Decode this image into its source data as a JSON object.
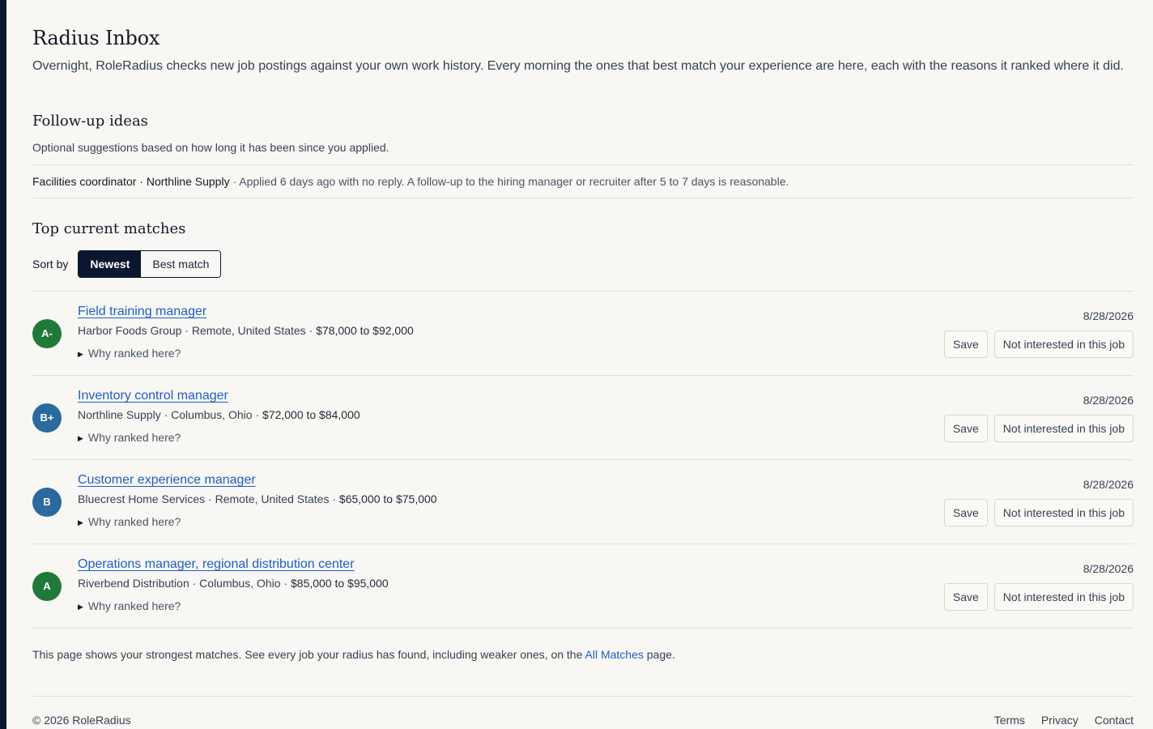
{
  "page": {
    "title": "Radius Inbox",
    "intro": "Overnight, RoleRadius checks new job postings against your own work history. Every morning the ones that best match your experience are here, each with the reasons it ranked where it did."
  },
  "followup": {
    "title": "Follow-up ideas",
    "subtitle": "Optional suggestions based on how long it has been since you applied.",
    "item": {
      "role": "Facilities coordinator",
      "sep": " · ",
      "company": "Northline Supply",
      "note": " · Applied 6 days ago with no reply. A follow-up to the hiring manager or recruiter after 5 to 7 days is reasonable."
    }
  },
  "matches": {
    "title": "Top current matches",
    "sort_label": "Sort by",
    "sort_options": [
      "Newest",
      "Best match"
    ],
    "sort_selected": "Newest",
    "save_label": "Save",
    "dismiss_label": "Not interested in this job",
    "why_label": "Why ranked here?",
    "jobs": [
      {
        "grade": "A-",
        "grade_color": "#1f7a3a",
        "title": "Field training manager",
        "meta": "Harbor Foods Group · Remote, United States · ",
        "salary": "$78,000 to $92,000",
        "date": "8/28/2026"
      },
      {
        "grade": "B+",
        "grade_color": "#2a6a9e",
        "title": "Inventory control manager",
        "meta": "Northline Supply · Columbus, Ohio · ",
        "salary": "$72,000 to $84,000",
        "date": "8/28/2026"
      },
      {
        "grade": "B",
        "grade_color": "#2a6a9e",
        "title": "Customer experience manager",
        "meta": "Bluecrest Home Services · Remote, United States · ",
        "salary": "$65,000 to $75,000",
        "date": "8/28/2026"
      },
      {
        "grade": "A",
        "grade_color": "#1f7a3a",
        "title": "Operations manager, regional distribution center",
        "meta": "Riverbend Distribution · Columbus, Ohio · ",
        "salary": "$85,000 to $95,000",
        "date": "8/28/2026"
      }
    ]
  },
  "footer": {
    "note_before": "This page shows your strongest matches. See every job your radius has found, including weaker ones, on the ",
    "note_link": "All Matches",
    "note_after": " page.",
    "copyright": "© 2026 RoleRadius",
    "links": [
      "Terms",
      "Privacy",
      "Contact"
    ]
  },
  "colors": {
    "accent": "#1d5fc4",
    "navy": "#0b1630",
    "background": "#f8f7f4"
  }
}
